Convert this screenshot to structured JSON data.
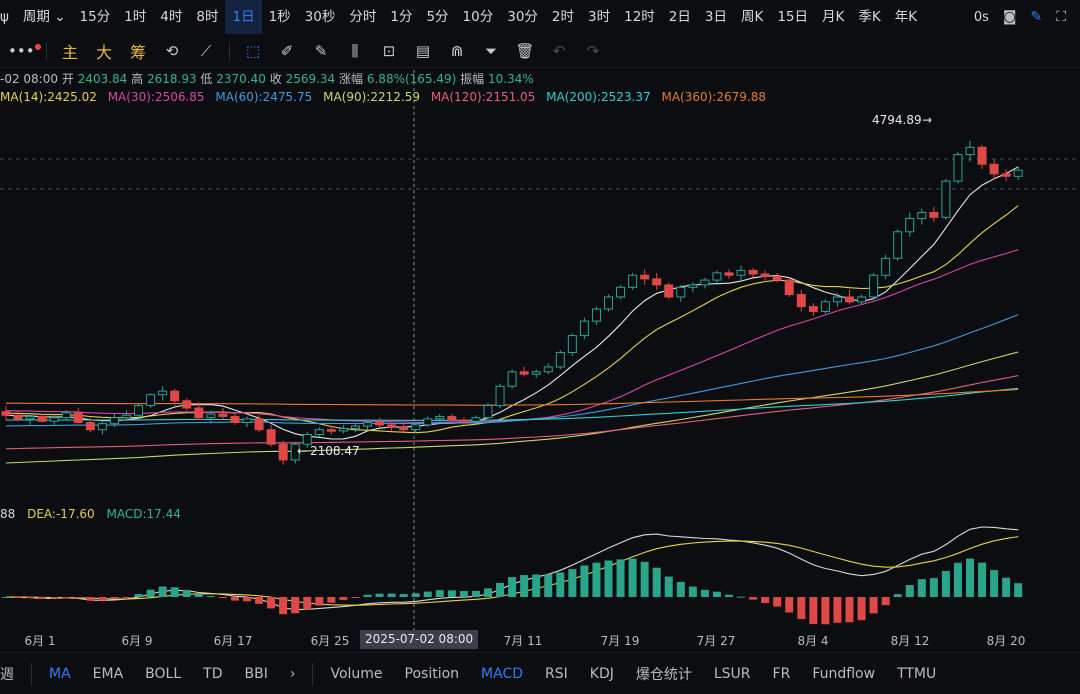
{
  "periods": {
    "lead": "ψ",
    "cycle": "周期",
    "items": [
      "15分",
      "1时",
      "4时",
      "8时",
      "1日",
      "1秒",
      "30秒",
      "分时",
      "1分",
      "5分",
      "10分",
      "30分",
      "2时",
      "3时",
      "12时",
      "2日",
      "3日",
      "周K",
      "15日",
      "月K",
      "季K",
      "年K"
    ]
  },
  "top_right": {
    "speed": "0s"
  },
  "toolbar": {
    "main": "主",
    "big": "大",
    "chip": "筹"
  },
  "ohlc": {
    "date": "-02 08:00",
    "open_label": "开",
    "open": "2403.84",
    "high_label": "高",
    "high": "2618.93",
    "low_label": "低",
    "low": "2370.40",
    "close_label": "收",
    "close": "2569.34",
    "change_label": "涨幅",
    "change": "6.88%(165.49)",
    "amp_label": "振幅",
    "amp": "10.34%"
  },
  "ma_legend": [
    {
      "text": "MA(14):2425.02",
      "color": "#e6d14a"
    },
    {
      "text": "MA(30):2506.85",
      "color": "#d646a8"
    },
    {
      "text": "MA(60):2475.75",
      "color": "#3f9be0"
    },
    {
      "text": "MA(90):2212.59",
      "color": "#c8d86a"
    },
    {
      "text": "MA(120):2151.05",
      "color": "#e4607a"
    },
    {
      "text": "MA(200):2523.37",
      "color": "#2ed0d0"
    },
    {
      "text": "MA(360):2679.88",
      "color": "#e87a2e"
    }
  ],
  "macd_legend": {
    "dif": "88",
    "dea": "DEA:-17.60",
    "macd": "MACD:17.44",
    "dif_color": "#d6d9de",
    "dea_color": "#e6d14a",
    "macd_color": "#33b58f"
  },
  "price_marks": {
    "high": "4794.89",
    "low": "2108.47"
  },
  "crosshair_date": "2025-07-02 08:00",
  "date_ticks": [
    "6月 1",
    "6月 9",
    "6月 17",
    "6月 25",
    "7月 11",
    "7月 19",
    "7月 27",
    "8月 4",
    "8月 12",
    "8月 20"
  ],
  "bottom": {
    "left": "週",
    "main_indicators": [
      "MA",
      "EMA",
      "BOLL",
      "TD",
      "BBI"
    ],
    "more": "›",
    "sub_indicators": [
      "Volume",
      "Position",
      "MACD",
      "RSI",
      "KDJ",
      "爆仓统计",
      "LSUR",
      "FR",
      "Fundflow",
      "TTMU"
    ]
  },
  "colors": {
    "up": "#26a69a",
    "down": "#e04848",
    "accent": "#2f7df6",
    "bg": "#0b0d10"
  },
  "chart_data": {
    "type": "candlestick",
    "x_ticks": [
      "6月 1",
      "6月 9",
      "6月 17",
      "6月 25",
      "7月 11",
      "7月 19",
      "7月 27",
      "8月 4",
      "8月 12",
      "8月 20"
    ],
    "candles": [
      [
        2550,
        2600,
        2480,
        2520
      ],
      [
        2520,
        2560,
        2470,
        2490
      ],
      [
        2490,
        2540,
        2440,
        2510
      ],
      [
        2510,
        2530,
        2460,
        2470
      ],
      [
        2470,
        2520,
        2430,
        2500
      ],
      [
        2500,
        2560,
        2480,
        2540
      ],
      [
        2540,
        2580,
        2450,
        2460
      ],
      [
        2460,
        2500,
        2380,
        2400
      ],
      [
        2400,
        2470,
        2360,
        2450
      ],
      [
        2450,
        2530,
        2420,
        2500
      ],
      [
        2500,
        2560,
        2470,
        2520
      ],
      [
        2520,
        2620,
        2490,
        2600
      ],
      [
        2600,
        2700,
        2580,
        2690
      ],
      [
        2690,
        2760,
        2640,
        2720
      ],
      [
        2720,
        2740,
        2600,
        2640
      ],
      [
        2640,
        2660,
        2560,
        2580
      ],
      [
        2580,
        2630,
        2480,
        2500
      ],
      [
        2500,
        2560,
        2450,
        2530
      ],
      [
        2530,
        2580,
        2490,
        2510
      ],
      [
        2510,
        2540,
        2440,
        2460
      ],
      [
        2460,
        2510,
        2420,
        2490
      ],
      [
        2490,
        2520,
        2380,
        2400
      ],
      [
        2400,
        2440,
        2260,
        2280
      ],
      [
        2280,
        2310,
        2110,
        2150
      ],
      [
        2150,
        2300,
        2120,
        2280
      ],
      [
        2280,
        2380,
        2250,
        2360
      ],
      [
        2360,
        2420,
        2340,
        2400
      ],
      [
        2400,
        2430,
        2360,
        2390
      ],
      [
        2390,
        2440,
        2370,
        2410
      ],
      [
        2410,
        2450,
        2380,
        2430
      ],
      [
        2430,
        2480,
        2400,
        2460
      ],
      [
        2460,
        2500,
        2420,
        2440
      ],
      [
        2440,
        2480,
        2390,
        2420
      ],
      [
        2420,
        2460,
        2380,
        2400
      ],
      [
        2400,
        2450,
        2370,
        2440
      ],
      [
        2440,
        2510,
        2420,
        2490
      ],
      [
        2490,
        2530,
        2450,
        2510
      ],
      [
        2510,
        2530,
        2460,
        2480
      ],
      [
        2480,
        2500,
        2440,
        2470
      ],
      [
        2470,
        2520,
        2450,
        2500
      ],
      [
        2500,
        2620,
        2490,
        2600
      ],
      [
        2600,
        2780,
        2580,
        2760
      ],
      [
        2760,
        2900,
        2740,
        2880
      ],
      [
        2880,
        2920,
        2840,
        2860
      ],
      [
        2860,
        2900,
        2830,
        2880
      ],
      [
        2880,
        2950,
        2860,
        2920
      ],
      [
        2920,
        3060,
        2900,
        3040
      ],
      [
        3040,
        3200,
        3010,
        3180
      ],
      [
        3180,
        3330,
        3150,
        3300
      ],
      [
        3300,
        3420,
        3270,
        3400
      ],
      [
        3400,
        3520,
        3380,
        3500
      ],
      [
        3500,
        3600,
        3480,
        3580
      ],
      [
        3580,
        3700,
        3560,
        3680
      ],
      [
        3680,
        3730,
        3600,
        3650
      ],
      [
        3650,
        3700,
        3560,
        3600
      ],
      [
        3600,
        3620,
        3480,
        3500
      ],
      [
        3500,
        3600,
        3460,
        3580
      ],
      [
        3580,
        3620,
        3540,
        3600
      ],
      [
        3600,
        3660,
        3570,
        3640
      ],
      [
        3640,
        3720,
        3610,
        3700
      ],
      [
        3700,
        3730,
        3650,
        3680
      ],
      [
        3680,
        3760,
        3640,
        3720
      ],
      [
        3720,
        3740,
        3660,
        3690
      ],
      [
        3690,
        3720,
        3640,
        3670
      ],
      [
        3670,
        3700,
        3620,
        3640
      ],
      [
        3640,
        3660,
        3500,
        3520
      ],
      [
        3520,
        3560,
        3380,
        3420
      ],
      [
        3420,
        3450,
        3340,
        3380
      ],
      [
        3380,
        3480,
        3360,
        3460
      ],
      [
        3460,
        3530,
        3420,
        3500
      ],
      [
        3500,
        3560,
        3440,
        3460
      ],
      [
        3460,
        3520,
        3440,
        3500
      ],
      [
        3500,
        3700,
        3480,
        3680
      ],
      [
        3680,
        3850,
        3650,
        3820
      ],
      [
        3820,
        4060,
        3800,
        4040
      ],
      [
        4040,
        4200,
        4000,
        4150
      ],
      [
        4150,
        4230,
        4100,
        4200
      ],
      [
        4200,
        4250,
        4120,
        4160
      ],
      [
        4160,
        4480,
        4140,
        4460
      ],
      [
        4460,
        4700,
        4440,
        4680
      ],
      [
        4680,
        4794,
        4620,
        4740
      ],
      [
        4740,
        4760,
        4560,
        4600
      ],
      [
        4600,
        4640,
        4480,
        4520
      ],
      [
        4520,
        4560,
        4460,
        4500
      ],
      [
        4500,
        4580,
        4470,
        4550
      ]
    ],
    "ylim": [
      2000,
      4900
    ]
  }
}
